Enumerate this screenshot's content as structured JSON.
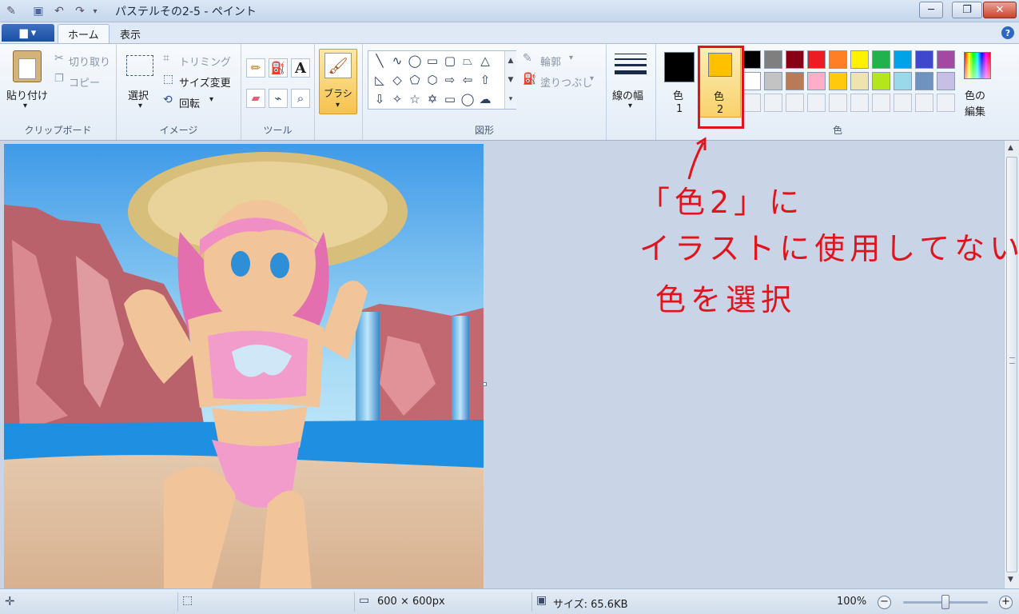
{
  "window": {
    "title": "パステルその2-5 - ペイント",
    "minimize": "─",
    "maximize": "❐",
    "close": "✕"
  },
  "tabs": {
    "file": "▆ ▾",
    "home": "ホーム",
    "view": "表示",
    "help": "?"
  },
  "clipboard": {
    "paste": "貼り付け",
    "cut": "切り取り",
    "copy": "コピー",
    "label": "クリップボード"
  },
  "image_group": {
    "select": "選択",
    "crop": "トリミング",
    "resize": "サイズ変更",
    "rotate": "回転",
    "label": "イメージ"
  },
  "tools": {
    "label": "ツール"
  },
  "brush": {
    "label": "ブラシ"
  },
  "shapes": {
    "outline": "輪郭",
    "fill": "塗りつぶし",
    "label": "図形"
  },
  "line_width": {
    "label": "線の幅"
  },
  "colors": {
    "color1_a": "色",
    "color1_b": "1",
    "color2_a": "色",
    "color2_b": "2",
    "edit_a": "色の",
    "edit_b": "編集",
    "label": "色",
    "color1": "#000000",
    "color2": "#ffc000",
    "palette_row1": [
      "#000000",
      "#7f7f7f",
      "#880015",
      "#ed1c24",
      "#ff7f27",
      "#fff200",
      "#22b14c",
      "#00a2e8",
      "#3f48cc",
      "#a349a4"
    ],
    "palette_row2": [
      "#ffffff",
      "#c3c3c3",
      "#b97a57",
      "#ffaec9",
      "#ffc90e",
      "#efe4b0",
      "#b5e61d",
      "#99d9ea",
      "#7092be",
      "#c8bfe7"
    ]
  },
  "annotation": {
    "line1": "「色2」に",
    "line2": "イラストに使用してない",
    "line3": "色を選択"
  },
  "status": {
    "image_size": "600 × 600px",
    "file_size": "サイズ: 65.6KB",
    "zoom": "100%",
    "zoom_value": 100
  }
}
